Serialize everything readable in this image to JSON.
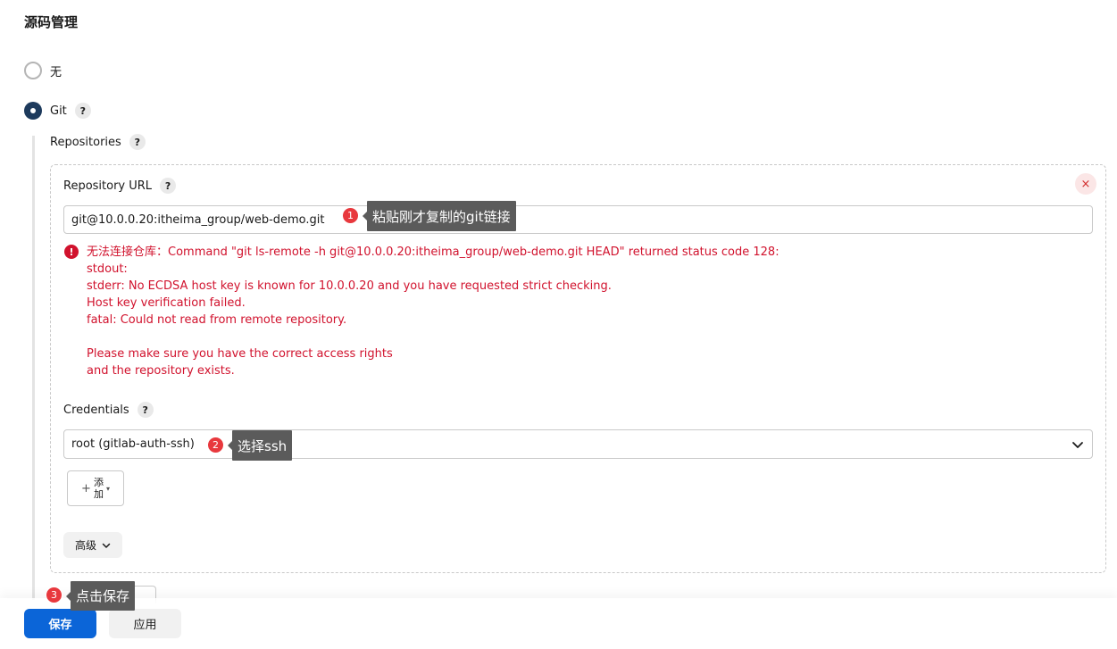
{
  "section": {
    "title": "源码管理"
  },
  "scm": {
    "options": [
      {
        "label": "无",
        "selected": false
      },
      {
        "label": "Git",
        "selected": true,
        "help": "?"
      }
    ]
  },
  "repositories": {
    "label": "Repositories",
    "help": "?",
    "remove": "×",
    "repository_url": {
      "label": "Repository URL",
      "help": "?",
      "value": "git@10.0.0.20:itheima_group/web-demo.git"
    },
    "error": {
      "icon": "!",
      "lines": [
        "无法连接仓库：Command \"git ls-remote -h git@10.0.0.20:itheima_group/web-demo.git HEAD\" returned status code 128:",
        "stdout:",
        "stderr: No ECDSA host key is known for 10.0.0.20 and you have requested strict checking.",
        "Host key verification failed.",
        "fatal: Could not read from remote repository.",
        "",
        "Please make sure you have the correct access rights",
        "and the repository exists."
      ],
      "color": "#d1122d"
    },
    "credentials": {
      "label": "Credentials",
      "help": "?",
      "selected": "root (gitlab-auth-ssh)"
    },
    "add_button": {
      "plus": "+",
      "label": "添加",
      "caret": "▾"
    },
    "advanced_button": {
      "label": "高级"
    }
  },
  "footer": {
    "save": "保存",
    "apply": "应用",
    "save_color": "#0b65d8"
  },
  "annotations": [
    {
      "number": "1",
      "text": "粘贴刚才复制的git链接"
    },
    {
      "number": "2",
      "text": "选择ssh"
    },
    {
      "number": "3",
      "text": "点击保存"
    }
  ]
}
